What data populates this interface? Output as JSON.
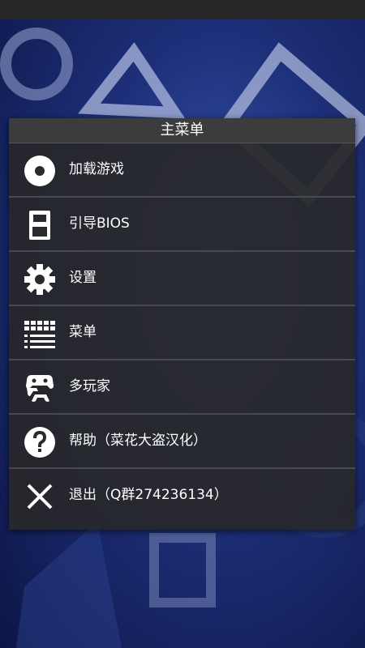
{
  "menu": {
    "title": "主菜单",
    "items": [
      {
        "label": "加载游戏",
        "icon": "disc-icon"
      },
      {
        "label": "引导BIOS",
        "icon": "memory-card-icon"
      },
      {
        "label": "设置",
        "icon": "gear-icon"
      },
      {
        "label": "菜单",
        "icon": "keyboard-menu-icon"
      },
      {
        "label": "多玩家",
        "icon": "gamepad-icon"
      },
      {
        "label": "帮助（菜花大盗汉化）",
        "icon": "help-icon"
      },
      {
        "label": "退出（Q群274236134）",
        "icon": "close-icon"
      }
    ]
  }
}
